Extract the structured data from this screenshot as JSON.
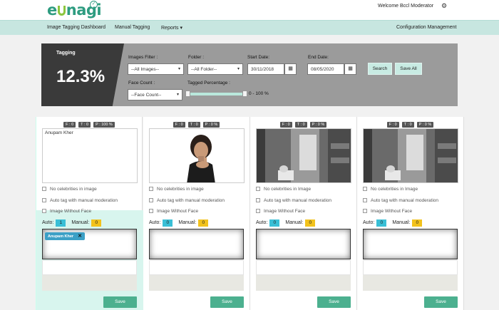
{
  "header": {
    "logo_text": "eunagi",
    "welcome": "Welcome Bccl Moderator",
    "settings_icon": "gear-icon"
  },
  "nav": {
    "items": [
      "Image Tagging Dashboard",
      "Manual Tagging",
      "Reports ▾"
    ],
    "right_item": "Configuration Management"
  },
  "filter": {
    "title": "Tagging",
    "percent": "12.3%",
    "images_filter_label": "Images Filter :",
    "images_filter_value": "--All Images--",
    "folder_label": "Folder :",
    "folder_value": "--All Folder--",
    "start_label": "Start Date:",
    "start_value": "30/11/2018",
    "end_label": "End Date:",
    "end_value": "08/05/2020",
    "search_label": "Search",
    "saveall_label": "Save All",
    "face_label": "Face Count :",
    "face_value": "--Face Count--",
    "tagged_label": "Tagged Percentage :",
    "tagged_range": "0 - 100 %"
  },
  "cards": [
    {
      "badges": [
        "F : 0",
        "T : 0",
        "P : 100 %"
      ],
      "image_alt": "Anupam Kher",
      "options": [
        "No celebrities in image",
        "Auto tag with manual moderation",
        "Image Without Face"
      ],
      "auto_label": "Auto:",
      "auto_value": "1",
      "manual_label": "Manual:",
      "manual_value": "0",
      "tags": [
        "Anupam Kher"
      ],
      "save_label": "Save"
    },
    {
      "badges": [
        "F : 0",
        "T : 0",
        "P : 0 %"
      ],
      "image_alt": "",
      "options": [
        "No celebrities in image",
        "Auto tag with manual moderation",
        "Image Without Face"
      ],
      "auto_label": "Auto:",
      "auto_value": "0",
      "manual_label": "Manual:",
      "manual_value": "0",
      "tags": [],
      "save_label": "Save"
    },
    {
      "badges": [
        "F : 0",
        "T : 0",
        "P : 0 %"
      ],
      "image_alt": "",
      "options": [
        "No celebrities in Image",
        "Auto tag with manual moderation",
        "Image Without Face"
      ],
      "auto_label": "Auto:",
      "auto_value": "0",
      "manual_label": "Manual:",
      "manual_value": "0",
      "tags": [],
      "save_label": "Save"
    },
    {
      "badges": [
        "F : 0",
        "T : 0",
        "P : 0 %"
      ],
      "image_alt": "",
      "options": [
        "No celebrities in Image",
        "Auto tag with manual moderation",
        "Image Without Face"
      ],
      "auto_label": "Auto:",
      "auto_value": "0",
      "manual_label": "Manual:",
      "manual_value": "0",
      "tags": [],
      "save_label": "Save"
    }
  ]
}
